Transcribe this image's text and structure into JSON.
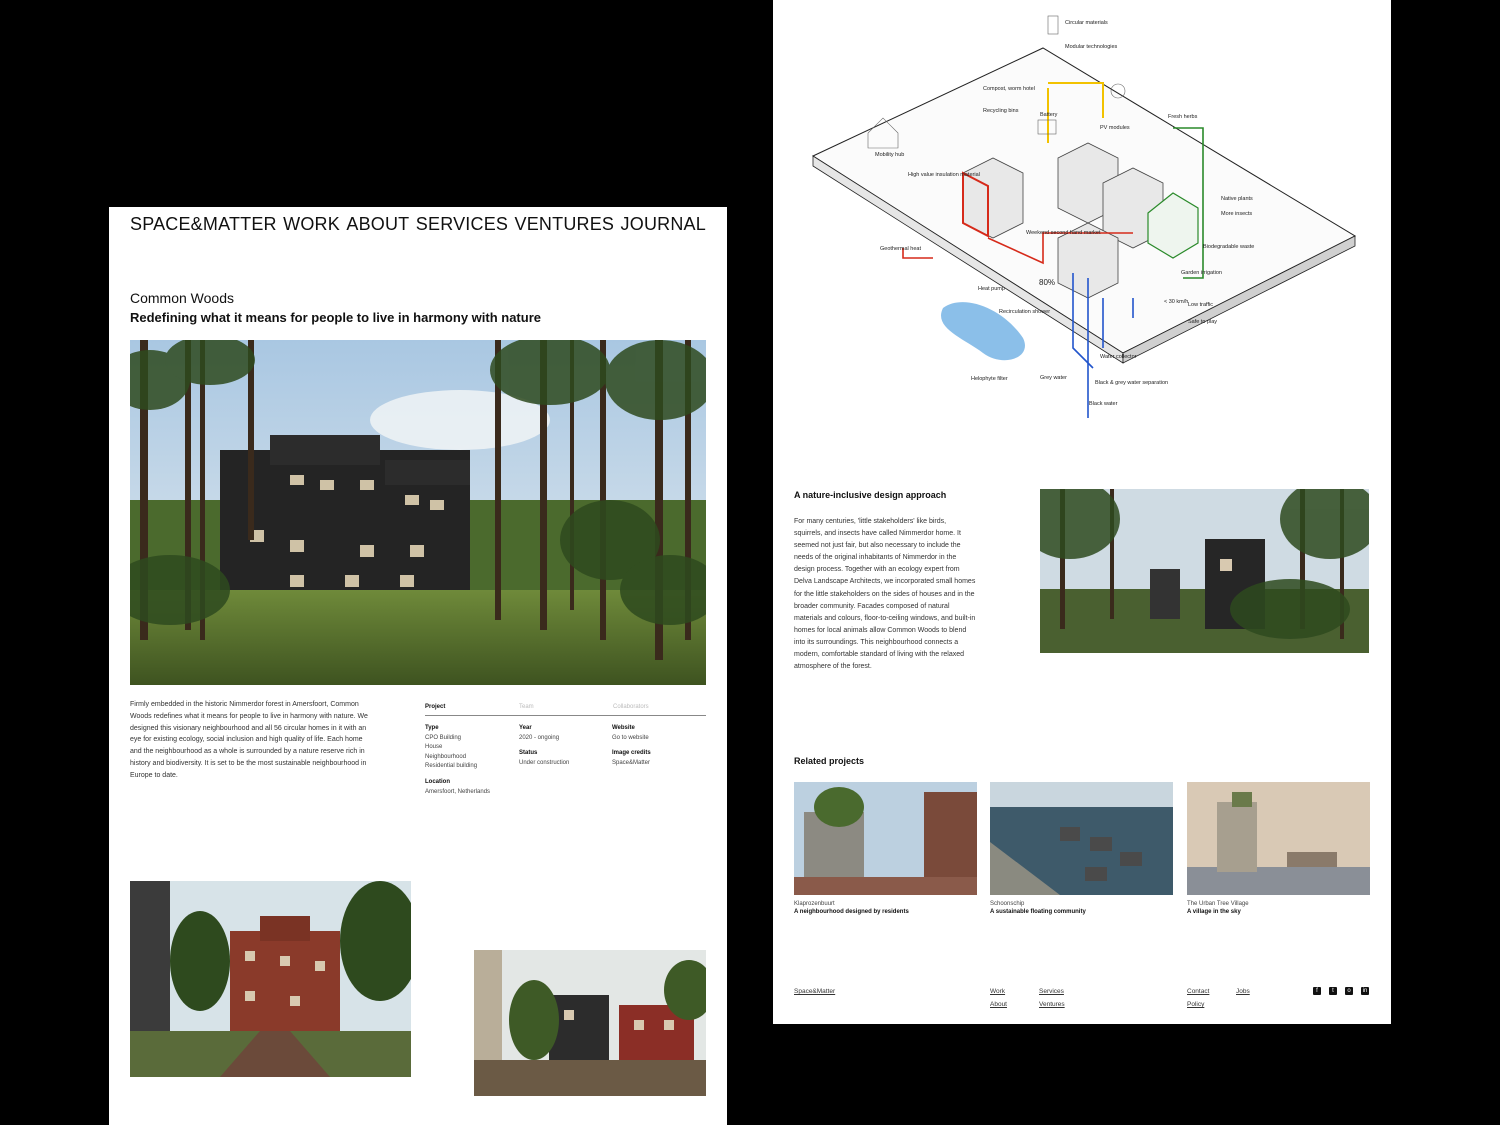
{
  "nav": {
    "brand": "SPACE&MATTER",
    "items": [
      "WORK",
      "ABOUT",
      "SERVICES",
      "VENTURES",
      "JOURNAL"
    ]
  },
  "project": {
    "title": "Common Woods",
    "subtitle": "Redefining what it means for people to live in harmony with nature",
    "intro": "Firmly embedded in the historic Nimmerdor forest in Amersfoort, Common Woods redefines what it means for people to live in harmony with nature. We designed this visionary neighbourhood and all 56 circular homes in it with an eye for existing ecology, social inclusion and high quality of life. Each home and the neighbourhood as a whole is surrounded by a nature reserve rich in history and biodiversity. It is set to be the most sustainable neighbourhood in Europe to date."
  },
  "meta": {
    "tabs": [
      "Project",
      "Team",
      "Collaborators"
    ],
    "type_label": "Type",
    "type_values": [
      "CPO Building",
      "House",
      "Neighbourhood",
      "Residential building"
    ],
    "location_label": "Location",
    "location_value": "Amersfoort, Netherlands",
    "year_label": "Year",
    "year_value": "2020 - ongoing",
    "status_label": "Status",
    "status_value": "Under construction",
    "website_label": "Website",
    "website_value": "Go to website",
    "credits_label": "Image credits",
    "credits_value": "Space&Matter"
  },
  "diagram": {
    "labels": [
      "Circular materials",
      "Modular technologies",
      "Compost, worm hotel",
      "Recycling bins",
      "Battery",
      "PV modules",
      "Fresh herbs",
      "Mobility hub",
      "High value insulation material",
      "Native plants",
      "More insects",
      "Weekend second hand market",
      "Geothermal heat",
      "Biodegradable waste",
      "Heat pump",
      "80%",
      "Garden irrigation",
      "Recirculation shower",
      "< 30 km/h",
      "Low traffic",
      "Safe to play",
      "Water collector",
      "Helophyte filter",
      "Grey water",
      "Black & grey water separation",
      "Black water"
    ]
  },
  "approach": {
    "title": "A nature-inclusive design approach",
    "body": "For many centuries, 'little stakeholders' like birds, squirrels, and insects have called Nimmerdor home. It seemed not just fair, but also necessary to include the needs of the original inhabitants of Nimmerdor in the design process. Together with an ecology expert from Delva Landscape Architects, we incorporated small homes for the little stakeholders on the sides of houses and in the broader community. Facades composed of natural materials and colours, floor-to-ceiling windows, and built-in homes for local animals allow Common Woods to blend into its surroundings. This neighbourhood connects a modern, comfortable standard of living with the relaxed atmosphere of the forest."
  },
  "related": {
    "title": "Related projects",
    "items": [
      {
        "name": "Klaprozenbuurt",
        "tagline": "A neighbourhood designed by residents"
      },
      {
        "name": "Schoonschip",
        "tagline": "A sustainable floating community"
      },
      {
        "name": "The Urban Tree Village",
        "tagline": "A village in the sky"
      }
    ]
  },
  "footer": {
    "brand": "Space&Matter",
    "links": [
      "Work",
      "Services",
      "About",
      "Ventures",
      "Contact",
      "Jobs",
      "Policy"
    ],
    "social": [
      "facebook-icon",
      "twitter-icon",
      "instagram-icon",
      "linkedin-icon"
    ]
  },
  "colors": {
    "background": "#000000",
    "panel": "#ffffff",
    "energy": "#f2c200",
    "heat": "#d62a1a",
    "water": "#2255cc",
    "nature": "#2a8a2a",
    "gray": "#cfcfcf"
  }
}
